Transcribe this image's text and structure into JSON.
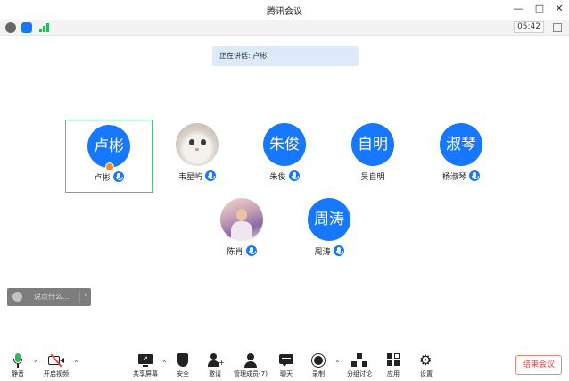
{
  "window": {
    "title": "腾讯会议"
  },
  "status": {
    "timer": "05:42"
  },
  "banner": {
    "speaking": "正在讲话: 卢彬;"
  },
  "participants": [
    {
      "avatar_text": "卢彬",
      "name": "卢彬"
    },
    {
      "avatar_text": "",
      "name": "韦星屿"
    },
    {
      "avatar_text": "朱俊",
      "name": "朱俊"
    },
    {
      "avatar_text": "自明",
      "name": "吴自明"
    },
    {
      "avatar_text": "淑琴",
      "name": "杨淑琴"
    },
    {
      "avatar_text": "",
      "name": "陈肖"
    },
    {
      "avatar_text": "周涛",
      "name": "周涛"
    }
  ],
  "chat": {
    "placeholder": "说点什么..."
  },
  "toolbar": {
    "mute": "静音",
    "video": "开启视频",
    "share": "共享屏幕",
    "security": "安全",
    "invite": "邀请",
    "members": "管理成员(7)",
    "chat": "聊天",
    "record": "录制",
    "breakout": "分组讨论",
    "apps": "应用",
    "settings": "设置",
    "end": "结束会议"
  },
  "colors": {
    "accent": "#1677ff",
    "active_border": "#3ccf76",
    "end": "#e54545"
  }
}
